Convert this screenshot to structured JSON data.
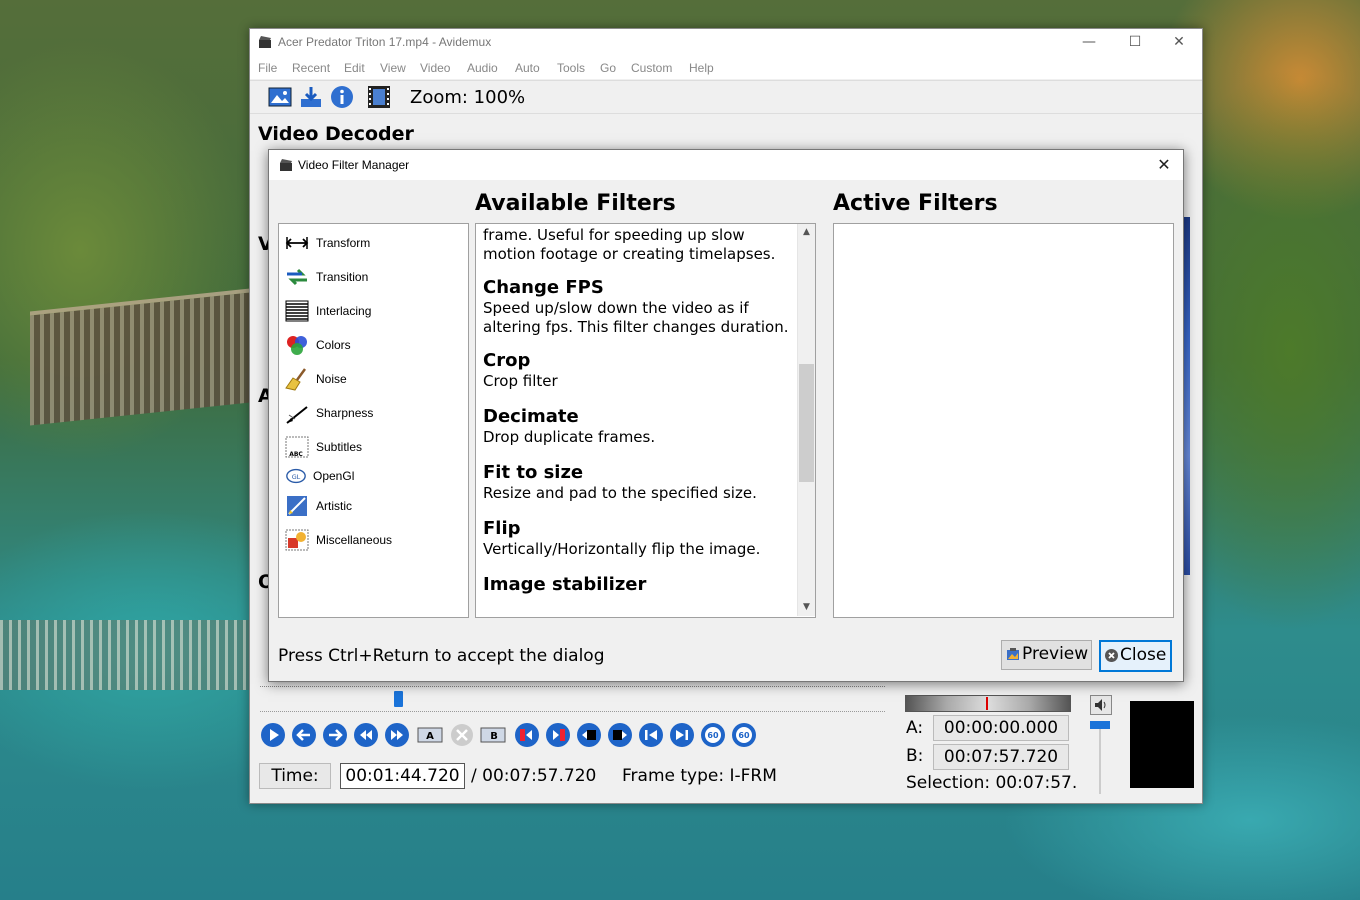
{
  "window": {
    "title": "Acer Predator Triton 17.mp4 - Avidemux",
    "controls": {
      "minimize": "—",
      "maximize": "☐",
      "close": "✕"
    }
  },
  "menubar": {
    "items": [
      "File",
      "Recent",
      "Edit",
      "View",
      "Video",
      "Audio",
      "Auto",
      "Tools",
      "Go",
      "Custom",
      "Help"
    ]
  },
  "toolbar": {
    "icons": [
      "open-image-icon",
      "save-icon",
      "info-icon",
      "film-icon"
    ],
    "zoom_label": "Zoom: 100%"
  },
  "main": {
    "video_decoder_heading": "Video Decoder",
    "partial_letters": [
      "V",
      "A",
      "O"
    ]
  },
  "dialog": {
    "title": "Video Filter Manager",
    "close": "✕",
    "available_heading": "Available Filters",
    "active_heading": "Active Filters",
    "categories": [
      {
        "label": "Transform",
        "icon": "transform-icon"
      },
      {
        "label": "Transition",
        "icon": "transition-icon"
      },
      {
        "label": "Interlacing",
        "icon": "interlacing-icon"
      },
      {
        "label": "Colors",
        "icon": "colors-icon"
      },
      {
        "label": "Noise",
        "icon": "noise-icon"
      },
      {
        "label": "Sharpness",
        "icon": "sharpness-icon"
      },
      {
        "label": "Subtitles",
        "icon": "subtitles-icon"
      },
      {
        "label": "OpenGl",
        "icon": "opengl-icon"
      },
      {
        "label": "Artistic",
        "icon": "artistic-icon"
      },
      {
        "label": "Miscellaneous",
        "icon": "miscellaneous-icon"
      }
    ],
    "filters_partial_top": "frame.  Useful for speeding up slow motion footage or creating timelapses.",
    "filters": [
      {
        "name": "Change FPS",
        "desc": "Speed up/slow down the video as if altering fps. This filter changes duration."
      },
      {
        "name": "Crop",
        "desc": "Crop filter"
      },
      {
        "name": "Decimate",
        "desc": "Drop duplicate frames."
      },
      {
        "name": "Fit to size",
        "desc": "Resize and pad to the specified size."
      },
      {
        "name": "Flip",
        "desc": "Vertically/Horizontally flip the image."
      },
      {
        "name": "Image stabilizer",
        "desc": ""
      }
    ],
    "hint": "Press Ctrl+Return to accept the dialog",
    "preview_button": "Preview",
    "close_button": "Close"
  },
  "playback": {
    "time_label": "Time:",
    "current_time": "00:01:44.720",
    "total_time": "/ 00:07:57.720",
    "frame_type": "Frame type: I-FRM",
    "a_label": "A:",
    "a_value": "00:00:00.000",
    "b_label": "B:",
    "b_value": "00:07:57.720",
    "selection": "Selection: 00:07:57.",
    "seek_position_fraction": 0.22
  }
}
